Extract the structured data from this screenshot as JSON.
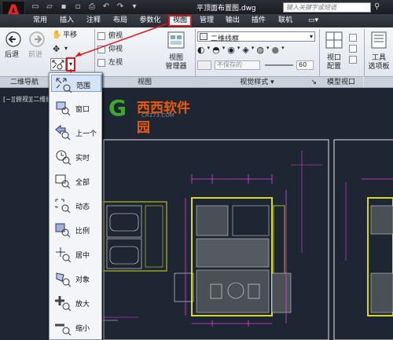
{
  "title_bar": {
    "filename": "平顶面布置图.dwg",
    "search_placeholder": "键入关键字或短语"
  },
  "menu_tabs": [
    {
      "label": "常用",
      "active": false
    },
    {
      "label": "插入",
      "active": false
    },
    {
      "label": "注释",
      "active": false
    },
    {
      "label": "布局",
      "active": false
    },
    {
      "label": "参数化",
      "active": false
    },
    {
      "label": "视图",
      "active": true
    },
    {
      "label": "管理",
      "active": false
    },
    {
      "label": "输出",
      "active": false
    },
    {
      "label": "插件",
      "active": false
    },
    {
      "label": "联机",
      "active": false
    }
  ],
  "ribbon": {
    "nav_panel": {
      "back": "后退",
      "forward": "前进",
      "pan": "平移",
      "title": "二维导航"
    },
    "views_panel": {
      "top": "俯视",
      "bottom": "仰视",
      "left": "左视",
      "manager": "视图管理器",
      "manager_line1": "视图",
      "manager_line2": "管理器",
      "title": "视图"
    },
    "visual_styles_panel": {
      "current": "二维线框",
      "not_saved": "不保存的",
      "number": "60",
      "title": "视觉样式"
    },
    "model_viewports_panel": {
      "viewport_config_line1": "视口",
      "viewport_config_line2": "配置",
      "title": "模型视口"
    },
    "tool_palettes": {
      "line1": "工具",
      "line2": "选项板"
    }
  },
  "viewport_label": "[−][俯视][二维线",
  "zoom_menu": [
    {
      "label": "范围",
      "selected": true
    },
    {
      "label": "窗口",
      "selected": false
    },
    {
      "label": "上一个",
      "selected": false
    },
    {
      "label": "实时",
      "selected": false
    },
    {
      "label": "全部",
      "selected": false
    },
    {
      "label": "动态",
      "selected": false
    },
    {
      "label": "比例",
      "selected": false
    },
    {
      "label": "居中",
      "selected": false
    },
    {
      "label": "对象",
      "selected": false
    },
    {
      "label": "放大",
      "selected": false
    },
    {
      "label": "缩小",
      "selected": false
    }
  ],
  "watermark": {
    "text": "西西软件园",
    "url": "CR173.COM"
  },
  "colors": {
    "highlight": "#e0141d",
    "canvas": "#1f2633",
    "cad_magenta": "#e040e0",
    "cad_yellow": "#d8d820",
    "cad_white": "#e8e8e8"
  }
}
